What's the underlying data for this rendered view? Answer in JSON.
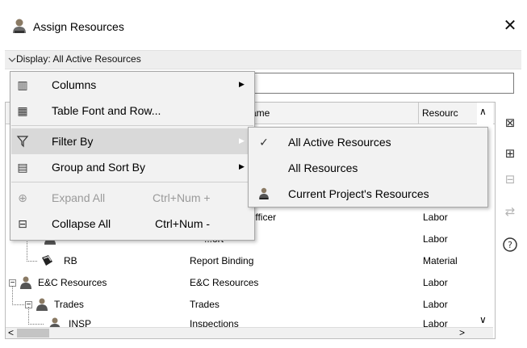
{
  "window": {
    "title": "Assign Resources",
    "close_glyph": "✕"
  },
  "display_bar": {
    "text": "Display: All Active Resources"
  },
  "search": {
    "placeholder": ""
  },
  "grid": {
    "headers": {
      "name": "ame",
      "resource_type": "Resourc"
    },
    "rows": [
      {
        "id": "",
        "name": "Officer",
        "type": "Labor"
      },
      {
        "id": "",
        "name": "...ort",
        "type": "Labor"
      },
      {
        "id": "RB",
        "name": "Report Binding",
        "type": "Material"
      },
      {
        "id": "E&C Resources",
        "name": "E&C Resources",
        "type": "Labor"
      },
      {
        "id": "Trades",
        "name": "Trades",
        "type": "Labor"
      },
      {
        "id": "INSP",
        "name": "Inspections",
        "type": "Labor"
      }
    ],
    "scroll": {
      "up": "∧",
      "down": "∨",
      "left": "<",
      "right": ">"
    }
  },
  "context_menu": {
    "items": [
      {
        "label": "Columns",
        "icon": "columns-icon"
      },
      {
        "label": "Table Font and Row...",
        "icon": "table-font-icon"
      },
      {
        "label": "Filter By",
        "icon": "filter-icon"
      },
      {
        "label": "Group and Sort By",
        "icon": "group-sort-icon"
      },
      {
        "label": "Expand All",
        "shortcut": "Ctrl+Num +",
        "icon": "expand-all-icon"
      },
      {
        "label": "Collapse All",
        "shortcut": "Ctrl+Num -",
        "icon": "collapse-all-icon"
      }
    ],
    "arrow": "▶"
  },
  "filter_submenu": {
    "items": [
      {
        "label": "All Active Resources",
        "checked": true,
        "icon": "check-icon"
      },
      {
        "label": "All Resources"
      },
      {
        "label": "Current Project's Resources",
        "icon": "user-icon"
      }
    ]
  },
  "colors": {
    "accent": "#f08a3c",
    "menu_bg": "#f2f2f2",
    "highlight": "#d9d9d9"
  }
}
